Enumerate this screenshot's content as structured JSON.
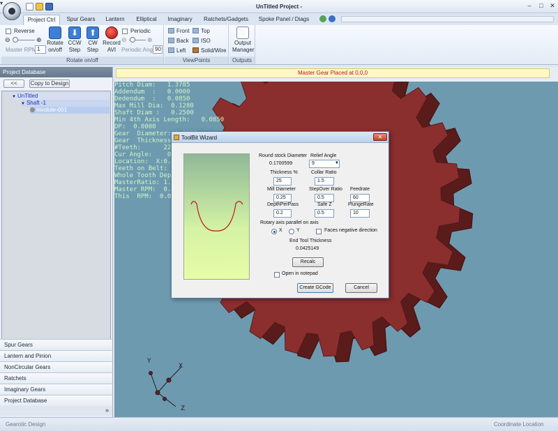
{
  "window": {
    "title": "UnTitled Project -"
  },
  "ribbon_tabs": [
    "Project Ctrl",
    "Spur Gears",
    "Lantern",
    "Elliptical",
    "Imaginary",
    "Ratchets/Gadgets",
    "Spoke Panel / Diags"
  ],
  "ribbon": {
    "rotate": {
      "reverse_label": "Reverse",
      "master_rpm_label": "Master RPM",
      "master_rpm_value": "1",
      "rotate_btn": [
        "Rotate",
        "on/off"
      ],
      "ccw_btn": [
        "CCW",
        "Step"
      ],
      "cw_btn": [
        "CW",
        "Step"
      ],
      "record_btn": [
        "Record",
        "AVI"
      ],
      "periodic_label": "Periodic",
      "periodic_ang_label": "Periodic Ang",
      "periodic_ang_value": "90",
      "group_label": "Rotate on/off"
    },
    "viewpoints": {
      "items": [
        "Front",
        "Top",
        "Back",
        "ISO",
        "Left",
        "Solid/Wire"
      ],
      "group_label": "ViewPoints"
    },
    "outputs": {
      "btn": [
        "Output",
        "Manager"
      ],
      "group_label": "Outputs"
    }
  },
  "left_pane": {
    "header": "Project Database",
    "back_btn": "<<",
    "copy_btn": "Copy to Design",
    "tree": {
      "root": "UnTitled",
      "shaft": "Shaft -1",
      "leaf": "Involute-001"
    },
    "nav": [
      "Spur Gears",
      "Lantern and Pinion",
      "NonCircular Gears",
      "Ratchets",
      "Imaginary Gears",
      "Project Database"
    ],
    "more": "»"
  },
  "viewport": {
    "banner": "Master Gear Placed at 0,0,0",
    "overlay_left": [
      "Pitch Diam:   1.3785",
      "Addendum  :   0.0000",
      "Dedendum  :   0.0850",
      "Max Mill Dia:  0.1280",
      "Shaft Diam :   0.2500",
      "Min 4th Axis Length:   0.0850"
    ],
    "overlay_right": [
      "DP:  0.0000",
      "Gear  Diameter: 1.3335",
      "Gear  Thickness: 0.2500",
      "#Teeth:      22.0000",
      "Cur Angle:    0.0000",
      "Location:  X:0.00,Y:0.00,Z:0.00",
      "Teeth on Belt: 22.00",
      "Whole Tooth Depth:    0.0850",
      "MasterRatio: 1.0000  :  1",
      "Master RPM:  0.0000",
      "This  RPM:  0.0000"
    ],
    "gear_color": "#8b2e2e"
  },
  "dialog": {
    "title": "ToolBit Wizard",
    "close": "✕",
    "round_stock_label": "Round stock Diameter",
    "round_stock_value": "0.1700599",
    "relief_angle_label": "Relief Angle",
    "relief_angle_value": "9",
    "thickness_label": "Thickness %",
    "thickness_value": "25",
    "collar_label": "Collar Ratio",
    "collar_value": "1.5",
    "mill_label": "Mill Diameter",
    "mill_value": "0.25",
    "stepover_label": "StepOver Ratio",
    "stepover_value": "0.5",
    "feedrate_label": "Feedrate",
    "feedrate_value": "60",
    "depth_label": "DepthPerPass",
    "depth_value": "0.2",
    "safez_label": "Safe Z",
    "safez_value": "0.5",
    "plunge_label": "PlungeRate",
    "plunge_value": "10",
    "rotary_label": "Rotary axis parallel on axis",
    "axis_x": "X",
    "axis_y": "Y",
    "faces_negative": "Faces negative direction",
    "end_tool_label": "End Tool Thickness",
    "end_tool_value": "0.0425149",
    "recalc_btn": "Recalc",
    "open_notepad": "Open in notepad",
    "create_btn": "Create GCode",
    "cancel_btn": "Cancel"
  },
  "statusbar": {
    "left": "Gearotic Design",
    "right": "Coordinate Location"
  }
}
